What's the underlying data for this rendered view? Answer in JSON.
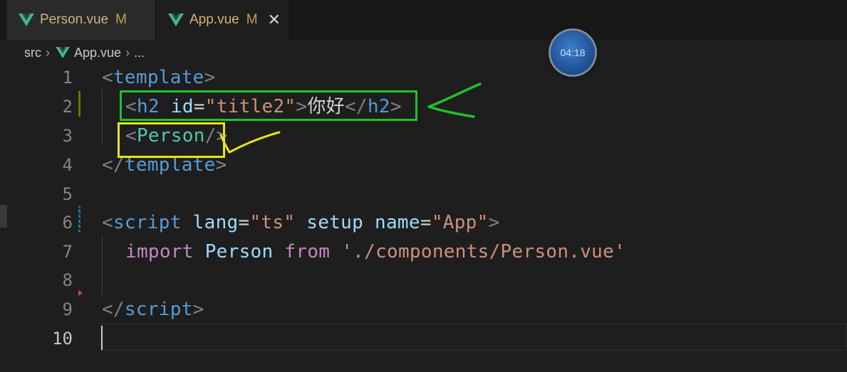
{
  "tabs": [
    {
      "label": "Person.vue",
      "status": "M",
      "active": false
    },
    {
      "label": "App.vue",
      "status": "M",
      "active": true,
      "close": "✕"
    }
  ],
  "breadcrumb": {
    "folder": "src",
    "file": "App.vue",
    "more": "..."
  },
  "timer": "04:18",
  "editor": {
    "line_numbers": [
      "1",
      "2",
      "3",
      "4",
      "5",
      "6",
      "7",
      "8",
      "9",
      "10"
    ],
    "line1": {
      "open": "<",
      "tag": "template",
      "close": ">"
    },
    "line2": {
      "open": "<",
      "tag": "h2",
      "attr": "id",
      "eq": "=",
      "value": "\"title2\"",
      "close": ">",
      "text": "你好",
      "end_open": "</",
      "end_tag": "h2",
      "end_close": ">"
    },
    "line3": {
      "open": "<",
      "comp": "Person",
      "close": "/>"
    },
    "line4": {
      "open": "</",
      "tag": "template",
      "close": ">"
    },
    "line6": {
      "open": "<",
      "tag": "script",
      "attr1": "lang",
      "eq1": "=",
      "val1": "\"ts\"",
      "attr2": "setup",
      "attr3": "name",
      "eq3": "=",
      "val3": "\"App\"",
      "close": ">"
    },
    "line7": {
      "kw1": "import",
      "ident": "Person",
      "kw2": "from",
      "str": "'./components/Person.vue'"
    },
    "line9": {
      "open": "</",
      "tag": "script",
      "close": ">"
    }
  },
  "colors": {
    "annotation_green": "#22c12a",
    "annotation_yellow": "#e7e41c",
    "vue_green": "#41b883"
  }
}
